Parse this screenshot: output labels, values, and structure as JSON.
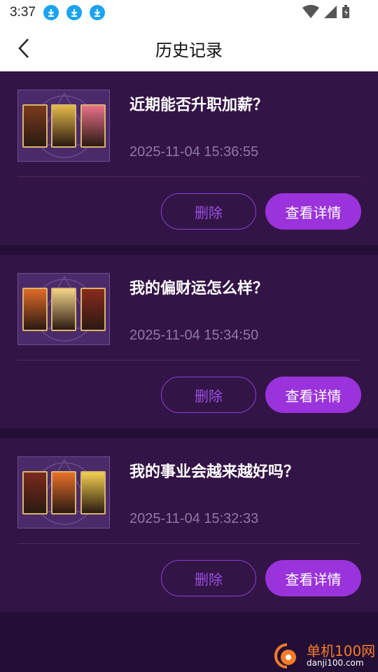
{
  "status": {
    "time": "3:37"
  },
  "header": {
    "title": "历史记录"
  },
  "records": [
    {
      "question": "近期能否升职加薪？",
      "time": "2025-11-04 15:36:55",
      "cards": [
        "#7a3a1e",
        "#e3b94a",
        "#e8708a"
      ],
      "delete_label": "删除",
      "detail_label": "查看详情"
    },
    {
      "question": "我的偏财运怎么样？",
      "time": "2025-11-04 15:34:50",
      "cards": [
        "#e06a2a",
        "#f2d48a",
        "#8a2a1e"
      ],
      "delete_label": "删除",
      "detail_label": "查看详情"
    },
    {
      "question": "我的事业会越来越好吗？",
      "time": "2025-11-04 15:32:33",
      "cards": [
        "#7a2a1e",
        "#e8702a",
        "#f2d050"
      ],
      "delete_label": "删除",
      "detail_label": "查看详情"
    }
  ],
  "watermark": {
    "name": "单机100网",
    "url": "danji100.com"
  }
}
